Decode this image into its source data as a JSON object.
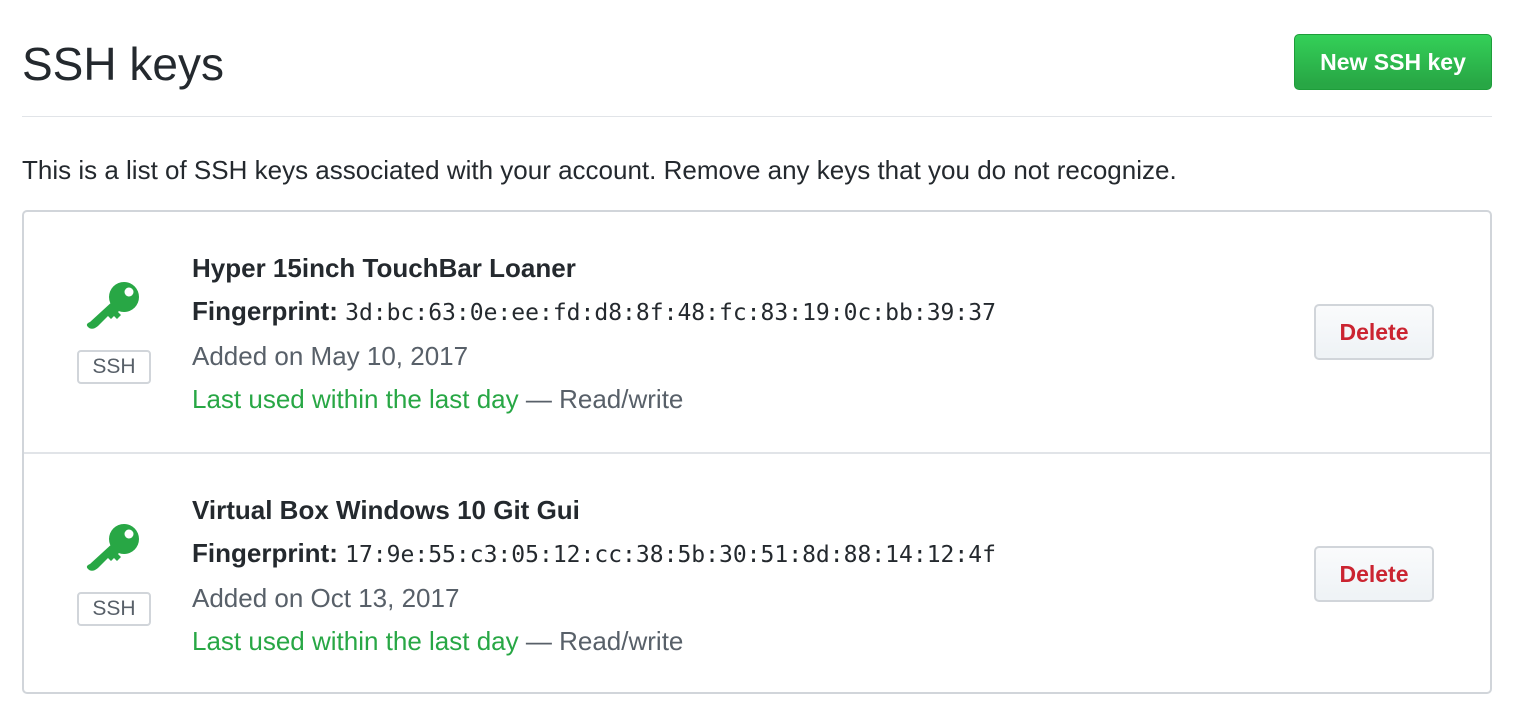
{
  "page": {
    "title": "SSH keys",
    "new_key_label": "New SSH key",
    "intro": "This is a list of SSH keys associated with your account. Remove any keys that you do not recognize."
  },
  "colors": {
    "accent_green": "#28a745",
    "danger_red": "#cb2431",
    "border": "#d1d5da"
  },
  "keys": [
    {
      "icon": "key-icon",
      "badge": "SSH",
      "title": "Hyper 15inch TouchBar Loaner",
      "fingerprint_label": "Fingerprint:",
      "fingerprint": "3d:bc:63:0e:ee:fd:d8:8f:48:fc:83:19:0c:bb:39:37",
      "added": "Added on May 10, 2017",
      "last_used": "Last used within the last day",
      "separator": "—",
      "access": "Read/write",
      "delete_label": "Delete"
    },
    {
      "icon": "key-icon",
      "badge": "SSH",
      "title": "Virtual Box Windows 10 Git Gui",
      "fingerprint_label": "Fingerprint:",
      "fingerprint": "17:9e:55:c3:05:12:cc:38:5b:30:51:8d:88:14:12:4f",
      "added": "Added on Oct 13, 2017",
      "last_used": "Last used within the last day",
      "separator": "—",
      "access": "Read/write",
      "delete_label": "Delete"
    }
  ]
}
